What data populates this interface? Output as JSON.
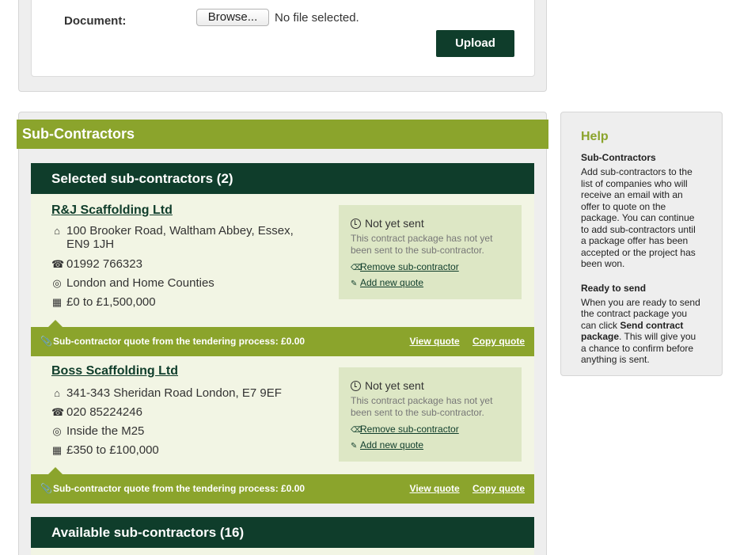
{
  "upload": {
    "document_label": "Document:",
    "browse_label": "Browse...",
    "file_status": "No file selected.",
    "upload_label": "Upload"
  },
  "section_title": "Sub-Contractors",
  "selected": {
    "heading": "Selected sub-contractors (2)",
    "items": [
      {
        "name": "R&J Scaffolding Ltd",
        "address": "100 Brooker Road, Waltham Abbey, Essex, EN9 1JH",
        "phone": "01992 766323",
        "area": "London and Home Counties",
        "range": "£0 to £1,500,000",
        "status_title": "Not yet sent",
        "status_desc": "This contract package has not yet been sent to the sub-contractor.",
        "remove_label": "Remove sub-contractor",
        "add_quote_label": "Add new quote",
        "quote_text": "Sub-contractor quote from the tendering process: £0.00",
        "view_quote": "View quote",
        "copy_quote": "Copy quote"
      },
      {
        "name": "Boss Scaffolding Ltd",
        "address": "341-343 Sheridan Road London, E7 9EF",
        "phone": "020 85224246",
        "area": "Inside the M25",
        "range": "£350 to £100,000",
        "status_title": "Not yet sent",
        "status_desc": "This contract package has not yet been sent to the sub-contractor.",
        "remove_label": "Remove sub-contractor",
        "add_quote_label": "Add new quote",
        "quote_text": "Sub-contractor quote from the tendering process: £0.00",
        "view_quote": "View quote",
        "copy_quote": "Copy quote"
      }
    ]
  },
  "available": {
    "heading": "Available sub-contractors (16)"
  },
  "help": {
    "title": "Help",
    "section1_heading": "Sub-Contractors",
    "section1_text": "Add sub-contractors to the list of companies who will receive an email with an offer to quote on the package. You can continue to add sub-contractors until a package offer has been accepted or the project has been won.",
    "section2_heading": "Ready to send",
    "section2_text_before": "When you are ready to send the contract package you can click",
    "section2_bold": "Send contract package",
    "section2_text_after": ". This will give you a chance to confirm before anything is sent."
  },
  "colors": {
    "dark_green": "#0f3d2b",
    "olive": "#8ba42c",
    "panel_bg": "#f2f5e4",
    "status_bg": "#dde7c5"
  }
}
